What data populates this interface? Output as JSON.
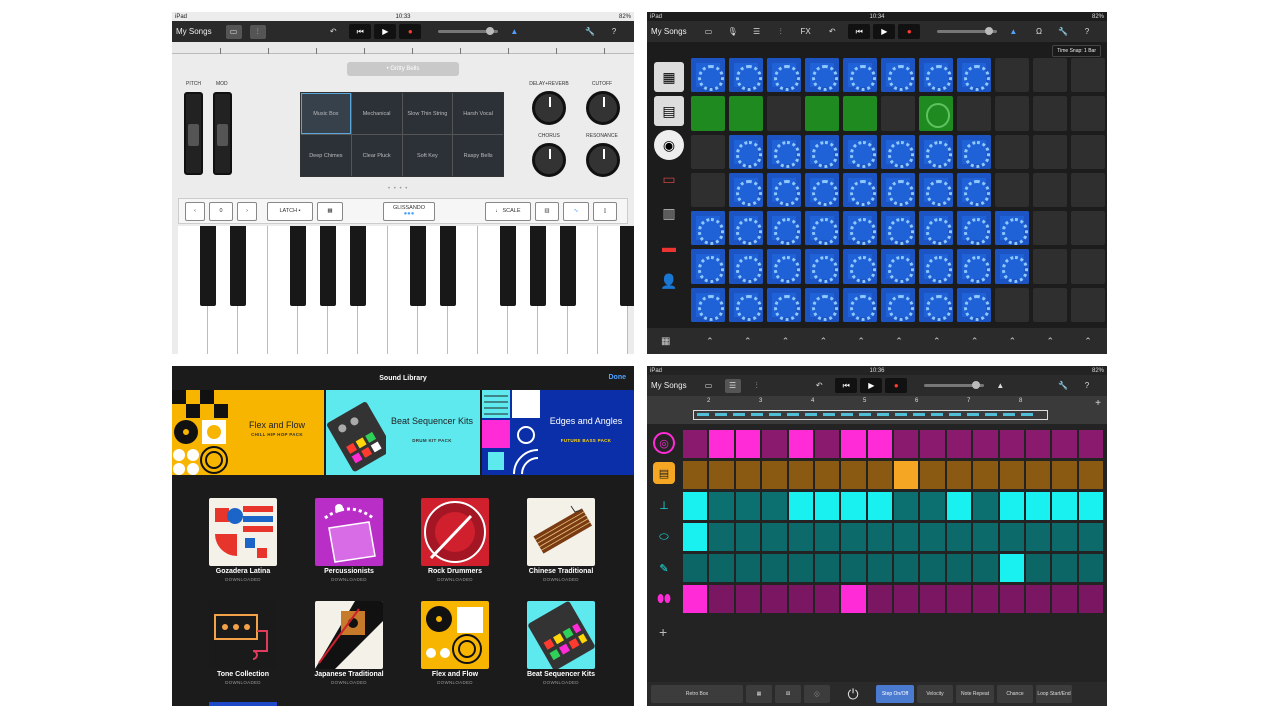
{
  "p1": {
    "status": {
      "device": "iPad",
      "time": "10:33",
      "battery": "82%"
    },
    "my_songs": "My Songs",
    "preset": "• Gritty Bells",
    "pitch": "PITCH",
    "mod": "MOD",
    "presets": [
      "Music Box",
      "Mechanical",
      "Slow Thin String",
      "Harsh Vocal",
      "Deep Chimes",
      "Clear Pluck",
      "Soft Key",
      "Raspy Bells"
    ],
    "knobs": [
      "DELAY+REVERB",
      "CUTOFF",
      "CHORUS",
      "RESONANCE"
    ],
    "octave": "0",
    "latch": "LATCH",
    "glissando": "GLISSANDO",
    "scale": "SCALE"
  },
  "p2": {
    "status": {
      "device": "iPad",
      "time": "10:34",
      "battery": "82%"
    },
    "my_songs": "My Songs",
    "fx": "FX",
    "time_snap": "Time Snap: 1 Bar",
    "grid": [
      [
        "b",
        "b",
        "b",
        "b",
        "b",
        "b",
        "b",
        "b",
        "e",
        "e",
        "e"
      ],
      [
        "g",
        "g",
        "e",
        "g",
        "g",
        "e",
        "gr",
        "e",
        "e",
        "e",
        "e"
      ],
      [
        "e",
        "b",
        "b",
        "b",
        "b",
        "b",
        "b",
        "b",
        "e",
        "e",
        "e"
      ],
      [
        "e",
        "b",
        "b",
        "b",
        "b",
        "b",
        "b",
        "b",
        "e",
        "e",
        "e"
      ],
      [
        "b",
        "b",
        "b",
        "b",
        "b",
        "b",
        "b",
        "b",
        "b",
        "e",
        "e"
      ],
      [
        "b",
        "b",
        "b",
        "b",
        "b",
        "b",
        "b",
        "b",
        "b",
        "e",
        "e"
      ],
      [
        "b",
        "b",
        "b",
        "b",
        "b",
        "b",
        "b",
        "b",
        "e",
        "e",
        "e"
      ]
    ]
  },
  "p3": {
    "title": "Sound Library",
    "done": "Done",
    "banners": [
      {
        "title": "Flex and Flow",
        "sub": "CHILL HIP HOP PACK"
      },
      {
        "title": "Beat Sequencer Kits",
        "sub": "DRUM KIT PACK"
      },
      {
        "title": "Edges and Angles",
        "sub": "FUTURE BASS PACK"
      }
    ],
    "packs": [
      {
        "name": "Gozadera Latina",
        "status": "DOWNLOADED"
      },
      {
        "name": "Percussionists",
        "status": "DOWNLOADED"
      },
      {
        "name": "Rock Drummers",
        "status": "DOWNLOADED"
      },
      {
        "name": "Chinese Traditional",
        "status": "DOWNLOADED"
      },
      {
        "name": "Tone Collection",
        "status": "DOWNLOADED"
      },
      {
        "name": "Japanese Traditional",
        "status": "DOWNLOADED"
      },
      {
        "name": "Flex and Flow",
        "status": "DOWNLOADED"
      },
      {
        "name": "Beat Sequencer Kits",
        "status": "DOWNLOADED"
      }
    ]
  },
  "p4": {
    "status": {
      "device": "iPad",
      "time": "10:36",
      "battery": "82%"
    },
    "my_songs": "My Songs",
    "bar_numbers": [
      "2",
      "3",
      "4",
      "5",
      "6",
      "7",
      "8"
    ],
    "rows": [
      {
        "color_on": "#ff2bd6",
        "color_off": "#8a1a6e",
        "steps": [
          0,
          1,
          1,
          0,
          1,
          0,
          1,
          1,
          0,
          0,
          0,
          0,
          0,
          0,
          0,
          0
        ]
      },
      {
        "color_on": "#f5a623",
        "color_off": "#8a5a12",
        "steps": [
          0,
          0,
          0,
          0,
          0,
          0,
          0,
          0,
          1,
          0,
          0,
          0,
          0,
          0,
          0,
          0
        ]
      },
      {
        "color_on": "#19f0f0",
        "color_off": "#0d7070",
        "steps": [
          1,
          0,
          0,
          0,
          1,
          1,
          1,
          1,
          0,
          0,
          1,
          0,
          1,
          1,
          1,
          1
        ]
      },
      {
        "color_on": "#19f0f0",
        "color_off": "#0d6a6a",
        "steps": [
          1,
          0,
          0,
          0,
          0,
          0,
          0,
          0,
          0,
          0,
          0,
          0,
          0,
          0,
          0,
          0
        ]
      },
      {
        "color_on": "#19f0f0",
        "color_off": "#0d6666",
        "steps": [
          0,
          0,
          0,
          0,
          0,
          0,
          0,
          0,
          0,
          0,
          0,
          0,
          1,
          0,
          0,
          0
        ]
      },
      {
        "color_on": "#ff2bd6",
        "color_off": "#7a1662",
        "steps": [
          1,
          0,
          0,
          0,
          0,
          0,
          1,
          0,
          0,
          0,
          0,
          0,
          0,
          0,
          0,
          0
        ]
      }
    ],
    "bottom": [
      "Retro Box",
      "Step On/Off",
      "Velocity",
      "Note Repeat",
      "Chance",
      "Loop Start/End"
    ]
  }
}
